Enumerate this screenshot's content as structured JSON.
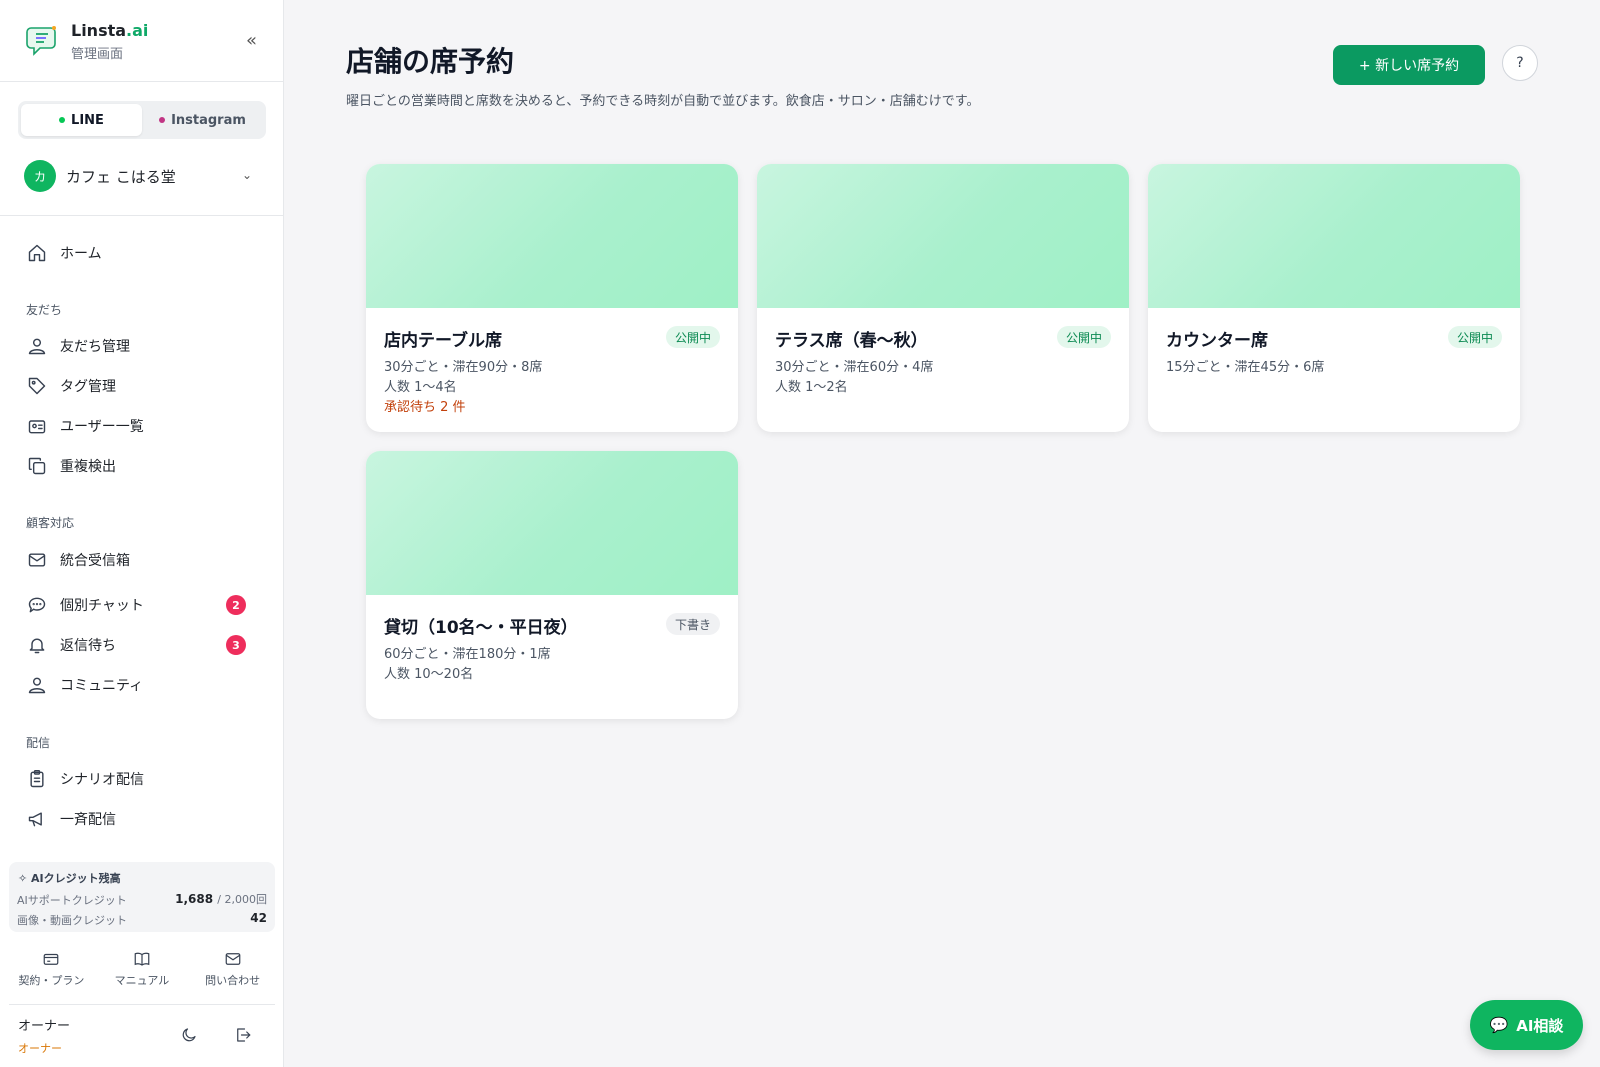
{
  "brand": {
    "name": "Linsta",
    "name_suffix": ".ai",
    "subtitle": "管理画面"
  },
  "channels": [
    {
      "label": "LINE",
      "color": "#06c755",
      "active": true
    },
    {
      "label": "Instagram",
      "color": "#c13584",
      "active": false
    }
  ],
  "account": {
    "initial": "カ",
    "name": "カフェ こはる堂"
  },
  "nav": {
    "home": "ホーム",
    "sections": [
      {
        "title": "友だち",
        "items": [
          "友だち管理",
          "タグ管理",
          "ユーザー一覧",
          "重複検出"
        ]
      },
      {
        "title": "顧客対応",
        "items": [
          "統合受信箱",
          "個別チャット",
          "返信待ち",
          "コミュニティ"
        ]
      },
      {
        "title": "配信",
        "items": [
          "シナリオ配信",
          "一斉配信"
        ]
      }
    ],
    "badges": {
      "chat": "2",
      "waiting": "3"
    }
  },
  "credits": {
    "title": "AIクレジット残高",
    "support_label": "AIサポートクレジット",
    "support_value": "1,688",
    "support_unit": "/ 2,000回",
    "media_label": "画像・動画クレジット",
    "media_value": "42"
  },
  "footer_links": [
    "契約・プラン",
    "マニュアル",
    "問い合わせ"
  ],
  "user": {
    "name": "オーナー",
    "role": "オーナー"
  },
  "main": {
    "title": "店舗の席予約",
    "description": "曜日ごとの営業時間と席数を決めると、予約できる時刻が自動で並びます。飲食店・サロン・店舗むけです。",
    "new_button": "+ 新しい席予約",
    "help": "?"
  },
  "cards": [
    {
      "title": "店内テーブル席",
      "status": "公開中",
      "meta1": "30分ごと・滞在90分・8席",
      "meta2": "人数 1〜4名",
      "pending": "承認待ち 2 件"
    },
    {
      "title": "テラス席（春〜秋）",
      "status": "公開中",
      "meta1": "30分ごと・滞在60分・4席",
      "meta2": "人数 1〜2名"
    },
    {
      "title": "カウンター席",
      "status": "公開中",
      "meta1": "15分ごと・滞在45分・6席"
    },
    {
      "title": "貸切（10名〜・平日夜）",
      "status": "下書き",
      "meta1": "60分ごと・滞在180分・1席",
      "meta2": "人数 10〜20名"
    }
  ],
  "ai_fab": "AI相談",
  "colors": {
    "accent": "#0b9a61",
    "badge_red": "#ee2d5c",
    "pending_orange": "#c2410c"
  }
}
